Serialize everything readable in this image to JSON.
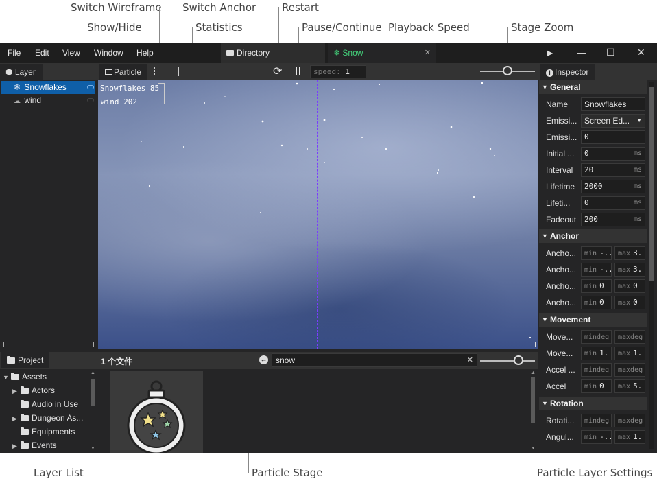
{
  "callouts": {
    "switch_wireframe": "Switch Wireframe",
    "switch_anchor": "Switch Anchor",
    "restart": "Restart",
    "show_hide": "Show/Hide",
    "statistics": "Statistics",
    "pause_continue": "Pause/Continue",
    "playback_speed": "Playback Speed",
    "stage_zoom": "Stage Zoom",
    "layer_list": "Layer List",
    "particle_stage": "Particle Stage",
    "particle_layer_settings": "Particle Layer Settings"
  },
  "menu": {
    "file": "File",
    "edit": "Edit",
    "view": "View",
    "window": "Window",
    "help": "Help"
  },
  "doc_tabs": {
    "directory": "Directory",
    "snow": "Snow",
    "close": "✕"
  },
  "window_controls": {
    "play": "▶",
    "minimize": "—",
    "maximize": "☐",
    "close": "✕"
  },
  "layer_panel": {
    "tab": "Layer",
    "items": [
      {
        "name": "Snowflakes",
        "selected": true
      },
      {
        "name": "wind",
        "selected": false
      }
    ]
  },
  "toolbar": {
    "particle_tab": "Particle",
    "speed_label": "speed:",
    "speed_value": "1"
  },
  "stage_zoom_level": 0.5,
  "stats": {
    "line1": "Snowflakes 85",
    "line2": "wind 202"
  },
  "inspector": {
    "tab": "Inspector",
    "general": {
      "title": "General",
      "name_label": "Name",
      "name_value": "Snowflakes",
      "emission_label": "Emissi...",
      "emission_value": "Screen Ed...",
      "emission2_label": "Emissi...",
      "emission2_value": "0",
      "initial_label": "Initial ...",
      "initial_value": "0",
      "initial_unit": "ms",
      "interval_label": "Interval",
      "interval_value": "20",
      "interval_unit": "ms",
      "lifetime_label": "Lifetime",
      "lifetime_value": "2000",
      "lifetime_unit": "ms",
      "lifeti_label": "Lifeti...",
      "lifeti_value": "0",
      "lifeti_unit": "ms",
      "fadeout_label": "Fadeout",
      "fadeout_value": "200",
      "fadeout_unit": "ms"
    },
    "anchor": {
      "title": "Anchor",
      "rows": [
        {
          "label": "Ancho...",
          "min_hint": "min",
          "min_value": "-..",
          "max_hint": "max",
          "max_value": "3."
        },
        {
          "label": "Ancho...",
          "min_hint": "min",
          "min_value": "-..",
          "max_hint": "max",
          "max_value": "3."
        },
        {
          "label": "Ancho...",
          "min_hint": "min",
          "min_value": "0",
          "max_hint": "max",
          "max_value": "0"
        },
        {
          "label": "Ancho...",
          "min_hint": "min",
          "min_value": "0",
          "max_hint": "max",
          "max_value": "0"
        }
      ]
    },
    "movement": {
      "title": "Movement",
      "rows": [
        {
          "label": "Move...",
          "min_hint": "mindeg",
          "min_value": "",
          "max_hint": "maxdeg",
          "max_value": ""
        },
        {
          "label": "Move...",
          "min_hint": "min",
          "min_value": "1.",
          "max_hint": "max",
          "max_value": "1."
        },
        {
          "label": "Accel ...",
          "min_hint": "mindeg",
          "min_value": "",
          "max_hint": "maxdeg",
          "max_value": ""
        },
        {
          "label": "Accel",
          "min_hint": "min",
          "min_value": "0",
          "max_hint": "max",
          "max_value": "5."
        }
      ]
    },
    "rotation": {
      "title": "Rotation",
      "rows": [
        {
          "label": "Rotati...",
          "min_hint": "mindeg",
          "min_value": "",
          "max_hint": "maxdeg",
          "max_value": ""
        },
        {
          "label": "Angul...",
          "min_hint": "min",
          "min_value": "-..",
          "max_hint": "max",
          "max_value": "1."
        }
      ]
    }
  },
  "project_panel": {
    "tab": "Project",
    "file_count": "1 个文件",
    "search_value": "snow",
    "tree": [
      {
        "name": "Assets",
        "expanded": true,
        "indent": 0,
        "arrow": "▼"
      },
      {
        "name": "Actors",
        "indent": 1,
        "arrow": "▶"
      },
      {
        "name": "Audio in Use",
        "indent": 1,
        "arrow": ""
      },
      {
        "name": "Dungeon As...",
        "indent": 1,
        "arrow": "▶"
      },
      {
        "name": "Equipments",
        "indent": 1,
        "arrow": ""
      },
      {
        "name": "Events",
        "indent": 1,
        "arrow": "▶"
      }
    ]
  },
  "colors": {
    "accent_green": "#43d07a",
    "selection_blue": "#0f5fa8",
    "guide_purple": "#7a3cff"
  }
}
